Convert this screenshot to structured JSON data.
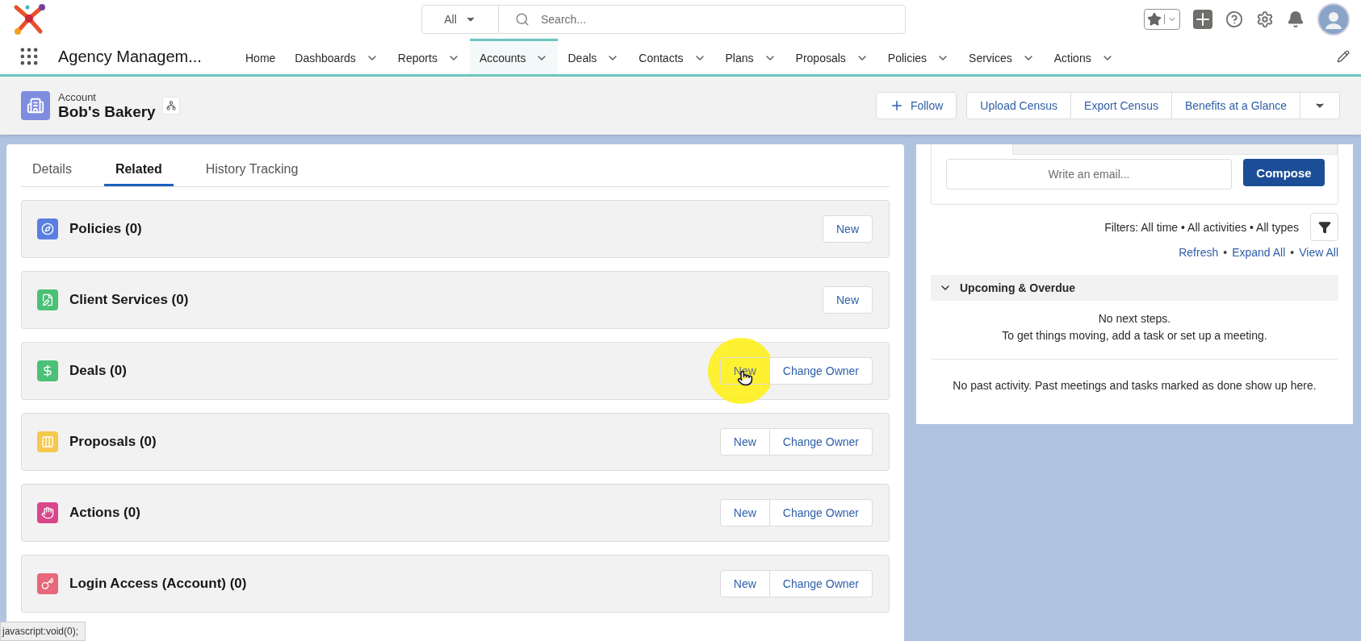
{
  "search": {
    "scope": "All",
    "placeholder": "Search..."
  },
  "nav": {
    "app_name": "Agency Managem...",
    "items": [
      {
        "label": "Home",
        "has_menu": false,
        "selected": false
      },
      {
        "label": "Dashboards",
        "has_menu": true,
        "selected": false
      },
      {
        "label": "Reports",
        "has_menu": true,
        "selected": false
      },
      {
        "label": "Accounts",
        "has_menu": true,
        "selected": true
      },
      {
        "label": "Deals",
        "has_menu": true,
        "selected": false
      },
      {
        "label": "Contacts",
        "has_menu": true,
        "selected": false
      },
      {
        "label": "Plans",
        "has_menu": true,
        "selected": false
      },
      {
        "label": "Proposals",
        "has_menu": true,
        "selected": false
      },
      {
        "label": "Policies",
        "has_menu": true,
        "selected": false
      },
      {
        "label": "Services",
        "has_menu": true,
        "selected": false
      },
      {
        "label": "Actions",
        "has_menu": true,
        "selected": false
      }
    ]
  },
  "header": {
    "object_type": "Account",
    "title": "Bob's Bakery",
    "follow": "Follow",
    "actions": [
      "Upload Census",
      "Export Census",
      "Benefits at a Glance"
    ]
  },
  "tabs": [
    {
      "label": "Details",
      "selected": false
    },
    {
      "label": "Related",
      "selected": true
    },
    {
      "label": "History Tracking",
      "selected": false
    }
  ],
  "related_lists": [
    {
      "title": "Policies (0)",
      "color": "#5a7fdf",
      "buttons": [
        "New"
      ],
      "cursor_highlight": false
    },
    {
      "title": "Client Services (0)",
      "color": "#4bc076",
      "buttons": [
        "New"
      ],
      "cursor_highlight": false
    },
    {
      "title": "Deals (0)",
      "color": "#4bc076",
      "buttons": [
        "New",
        "Change Owner"
      ],
      "cursor_highlight": true
    },
    {
      "title": "Proposals (0)",
      "color": "#f5c94f",
      "buttons": [
        "New",
        "Change Owner"
      ],
      "cursor_highlight": false
    },
    {
      "title": "Actions (0)",
      "color": "#d9468a",
      "buttons": [
        "New",
        "Change Owner"
      ],
      "cursor_highlight": false
    },
    {
      "title": "Login Access (Account) (0)",
      "color": "#e8677a",
      "buttons": [
        "New",
        "Change Owner"
      ],
      "cursor_highlight": false
    }
  ],
  "activity": {
    "email_placeholder": "Write an email...",
    "compose": "Compose",
    "filters": "Filters: All time • All activities • All types",
    "links": [
      "Refresh",
      "Expand All",
      "View All"
    ],
    "link_separator": "•",
    "section": {
      "title": "Upcoming & Overdue",
      "expanded": true,
      "empty": [
        "No next steps.",
        "To get things moving, add a task or set up a meeting."
      ]
    },
    "past": "No past activity. Past meetings and tasks marked as done show up here."
  },
  "status_bar": "javascript:void(0);"
}
